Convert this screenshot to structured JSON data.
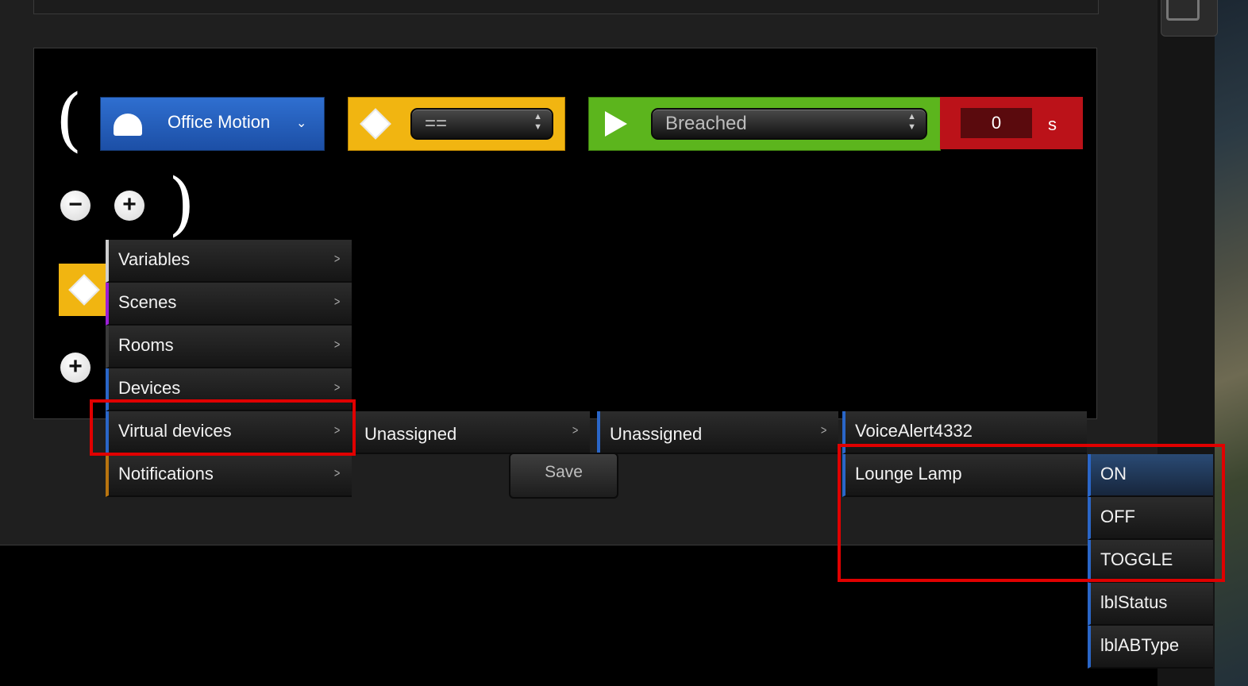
{
  "condition": {
    "open_paren": "(",
    "close_paren": ")",
    "device": {
      "name": "Office Motion",
      "caret": "⌄"
    },
    "operator": {
      "value": "==",
      "arrows": "▲\n▼"
    },
    "state": {
      "value": "Breached",
      "arrows": "▲\n▼"
    },
    "delay": {
      "value": "0",
      "unit": "s"
    }
  },
  "buttons": {
    "minus": "−",
    "plus": "+",
    "plus2": "+",
    "save": "Save"
  },
  "menu": {
    "chevron": ">",
    "categories": [
      {
        "label": "Variables",
        "color": "#cfcfcf"
      },
      {
        "label": "Scenes",
        "color": "#9b1fd6"
      },
      {
        "label": "Rooms",
        "color": "#3a3a3a"
      },
      {
        "label": "Devices",
        "color": "#2a66c8"
      },
      {
        "label": "Virtual devices",
        "color": "#2a66c8"
      },
      {
        "label": "Notifications",
        "color": "#b8740f"
      }
    ],
    "section": "Unassigned",
    "room": "Unassigned",
    "virtual_devices": [
      "VoiceAlert4332",
      "Lounge Lamp"
    ],
    "actions": [
      "ON",
      "OFF",
      "TOGGLE",
      "lblStatus",
      "lblABType"
    ]
  }
}
